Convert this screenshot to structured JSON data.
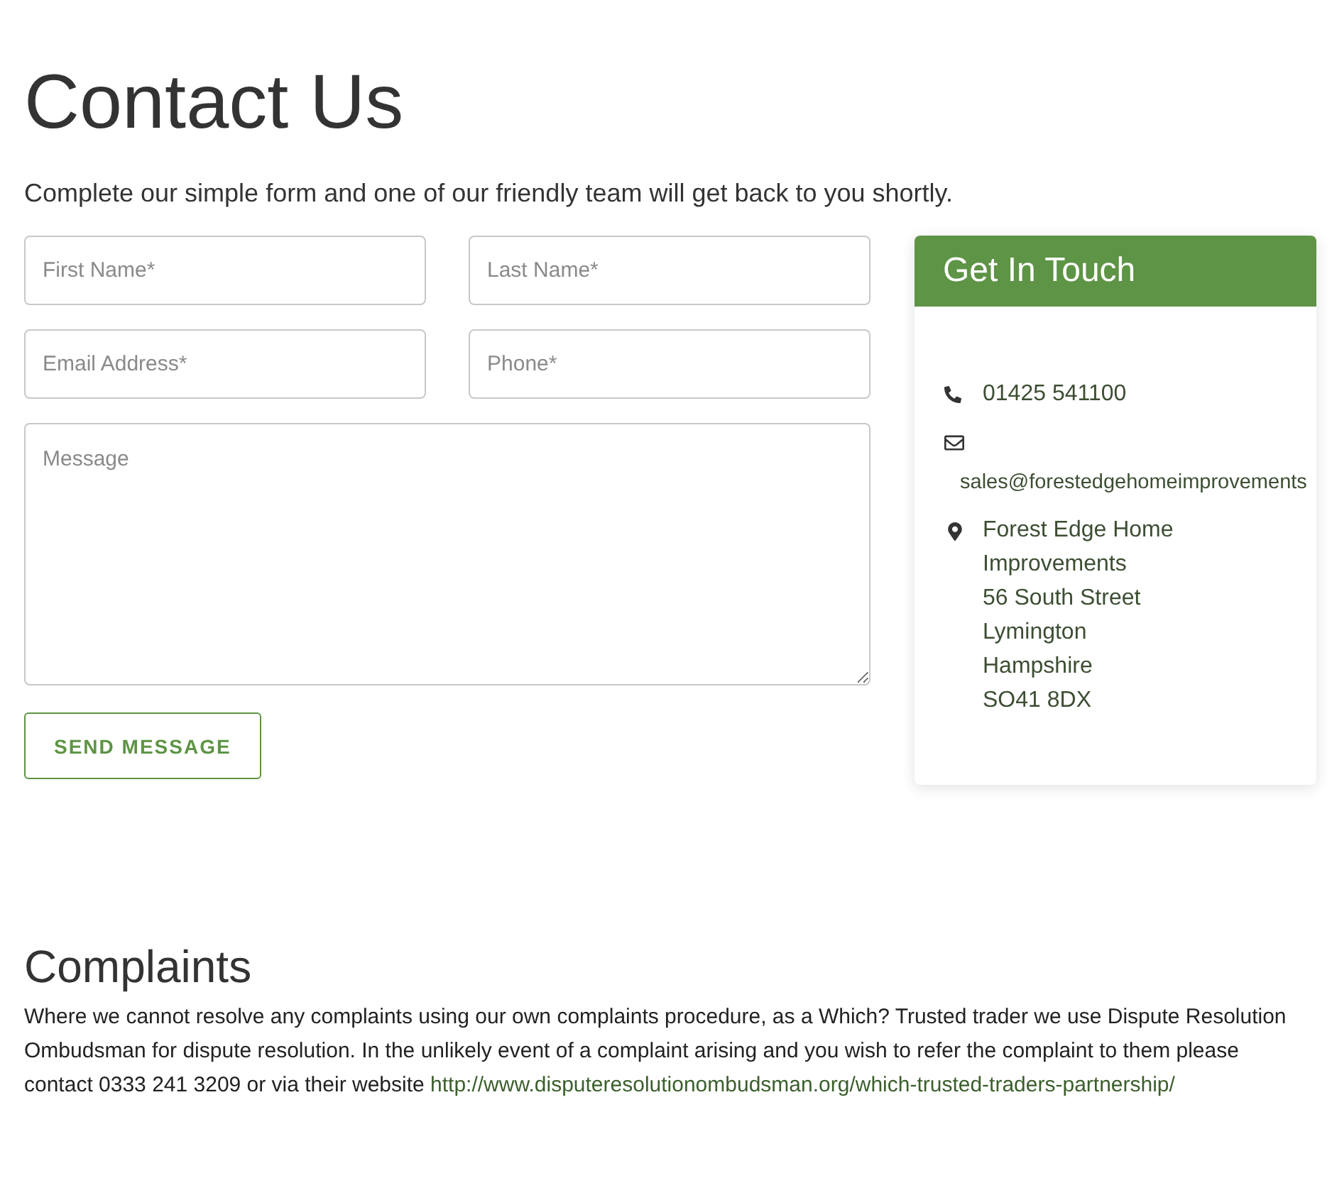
{
  "header": {
    "title": "Contact Us",
    "subtitle": "Complete our simple form and one of our friendly team will get back to you shortly."
  },
  "form": {
    "fields": [
      {
        "kind": "input",
        "placeholder": "First Name*"
      },
      {
        "kind": "input",
        "placeholder": "Last Name*"
      },
      {
        "kind": "input",
        "placeholder": "Email Address*"
      },
      {
        "kind": "input",
        "placeholder": "Phone*"
      },
      {
        "kind": "textarea",
        "placeholder": "Message"
      }
    ],
    "submit": "SEND MESSAGE"
  },
  "contact_card": {
    "title": "Get In Touch",
    "items": [
      {
        "kind": "phone",
        "lines": [
          "01425 541100"
        ]
      },
      {
        "kind": "email",
        "lines": [
          "sales@forestedgehomeimprovements"
        ]
      },
      {
        "kind": "address",
        "lines": [
          "Forest Edge Home",
          "Improvements",
          "56 South Street",
          "Lymington",
          "Hampshire",
          "SO41 8DX"
        ]
      }
    ]
  },
  "complaints": {
    "title": "Complaints",
    "text": "Where we cannot resolve any complaints using our own complaints procedure, as a Which? Trusted trader we use Dispute Resolution Ombudsman for dispute resolution. In the unlikely event of a complaint arising and you wish to refer the complaint to them please contact 0333 241 3209 or via their website",
    "link": "http://www.disputeresolutionombudsman.org/which-trusted-traders-partnership/"
  }
}
